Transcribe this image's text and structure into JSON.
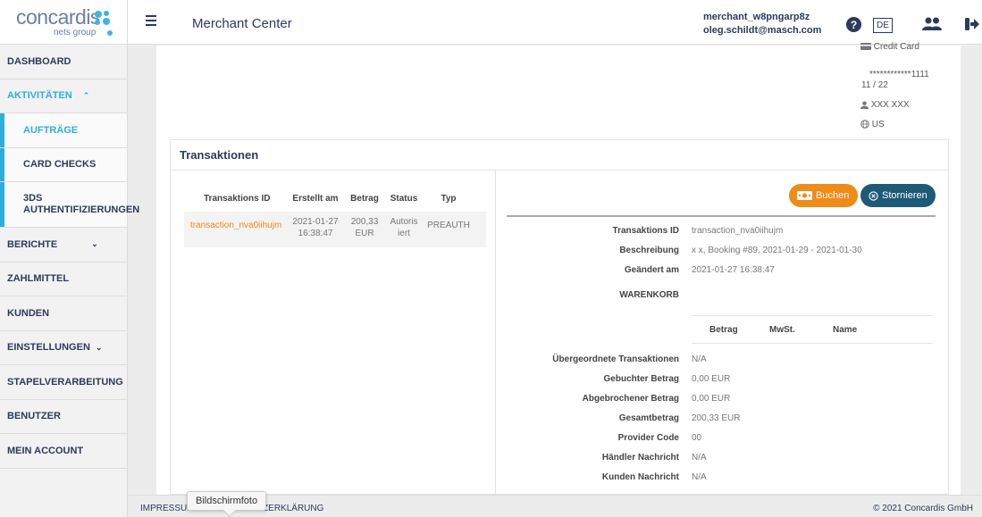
{
  "brand": {
    "name": "concardis",
    "sub": "nets group"
  },
  "header": {
    "title": "Merchant Center",
    "user_name": "merchant_w8pngarp8z",
    "user_email": "oleg.schildt@masch.com",
    "language": "DE"
  },
  "sidebar": {
    "items": [
      {
        "label": "DASHBOARD"
      },
      {
        "label": "AKTIVITÄTEN"
      },
      {
        "label": "AUFTRÄGE"
      },
      {
        "label": "CARD CHECKS"
      },
      {
        "label": "3DS AUTHENTIFIZIERUNGEN"
      },
      {
        "label": "BERICHTE"
      },
      {
        "label": "ZAHLMITTEL"
      },
      {
        "label": "KUNDEN"
      },
      {
        "label": "EINSTELLUNGEN"
      },
      {
        "label": "STAPELVERARBEITUNG"
      },
      {
        "label": "BENUTZER"
      },
      {
        "label": "MEIN ACCOUNT"
      }
    ]
  },
  "card_info": {
    "type": "Credit Card",
    "number": "************1111",
    "expiry": "11 / 22",
    "holder": "XXX XXX",
    "country": "US"
  },
  "transactions": {
    "title": "Transaktionen",
    "columns": [
      "Transaktions ID",
      "Erstellt am",
      "Betrag",
      "Status",
      "Typ"
    ],
    "rows": [
      {
        "id": "transaction_nva0iihujm",
        "created_date": "2021-01-27",
        "created_time": "16:38:47",
        "amount": "200,33",
        "currency": "EUR",
        "status_a": "Autoris",
        "status_b": "iert",
        "type": "PREAUTH"
      }
    ]
  },
  "actions": {
    "book": "Buchen",
    "cancel": "Stornieren"
  },
  "details": {
    "id_label": "Transaktions ID",
    "id_value": "transaction_nva0iihujm",
    "desc_label": "Beschreibung",
    "desc_value": "x x, Booking #89, 2021-01-29 - 2021-01-30",
    "changed_label": "Geändert am",
    "changed_value": "2021-01-27 16:38:47",
    "cart_label": "WARENKORB",
    "cart_columns": [
      "Betrag",
      "MwSt.",
      "Name"
    ],
    "parent_label": "Übergeordnete Transaktionen",
    "parent_value": "N/A",
    "booked_label": "Gebuchter Betrag",
    "booked_value": "0,00 EUR",
    "aborted_label": "Abgebrochener Betrag",
    "aborted_value": "0,00 EUR",
    "total_label": "Gesamtbetrag",
    "total_value": "200,33 EUR",
    "provider_label": "Provider Code",
    "provider_value": "00",
    "merchant_msg_label": "Händler Nachricht",
    "merchant_msg_value": "N/A",
    "customer_msg_label": "Kunden Nachricht",
    "customer_msg_value": "N/A"
  },
  "footer": {
    "left": "IMPRESSUM  ·  DATENSCHUTZERKLÄRUNG",
    "copyright": "© 2021 Concardis GmbH"
  },
  "tooltip": "Bildschirmfoto",
  "colors": {
    "accent": "#2eaee0",
    "navy": "#2d3a5c",
    "orange": "#ee8b19",
    "teal": "#1d5a78"
  }
}
